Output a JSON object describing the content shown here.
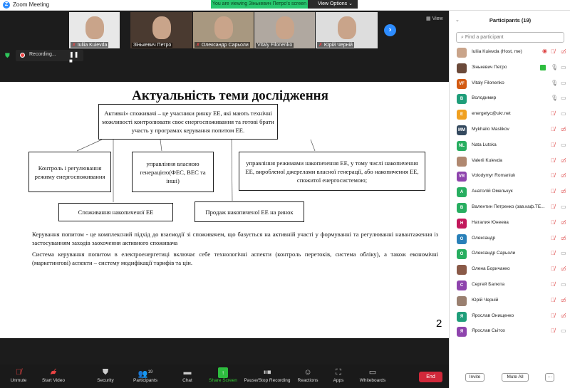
{
  "window": {
    "title": "Zoom Meeting",
    "viewing_banner": "You are viewing Зіньке­вич Петро's screen",
    "view_options": "View Options"
  },
  "videos": [
    {
      "name": "Iuliia Kuievda",
      "muted": true
    },
    {
      "name": "Зінькевич Петро",
      "muted": false
    },
    {
      "name": "Олександр Сарьоли",
      "muted": true
    },
    {
      "name": "Vitaly Filonenko",
      "muted": false
    },
    {
      "name": "Юрій Черній",
      "muted": true
    }
  ],
  "view_label": "View",
  "recording": {
    "label": "Recording..."
  },
  "slide": {
    "title": "Актуальність теми дослідження",
    "definition": "Активні» споживачі – це учасники ринку ЕЕ, які мають технічні можливості контролювати своє енергоспоживання та готові брати участь у програмах керування попитом ЕЕ.",
    "box_control": "Контроль і регулювання режиму енергоспоживання",
    "box_generation": "управління власною генерацією(ФЕС, ВЕС та інші)",
    "box_storage": "управління режимами накопичення ЕЕ, у тому числі накопичення ЕЕ, виробленої джерелами власної генерації, або накопичення ЕЕ, спожитої енергосистемою;",
    "box_consumption": "Споживання накопиченої ЕЕ",
    "box_sale": "Продаж накопиченої ЕЕ на ринок",
    "para1": "Керування попитом - це комплексний підхід до взаємодії зі споживачем, що базується на активній участі у формуванні та регулюванні навантаження із застосуванням заходів заохочення активного споживача",
    "para2": "Система керування попитом в електроенергетиці включає себе технологічні аспекти (контроль перетоків, система обліку), а також економічні (маркетингові) аспекти – систему модифікації тарифів та цін.",
    "page_number": "2"
  },
  "toolbar": {
    "unmute": "Unmute",
    "start_video": "Start Video",
    "security": "Security",
    "participants": "Participants",
    "participants_count": "19",
    "chat": "Chat",
    "share_screen": "Share Screen",
    "pause_stop": "Pause/Stop Recording",
    "reactions": "Reactions",
    "apps": "Apps",
    "whiteboards": "Whiteboards",
    "end": "End"
  },
  "panel": {
    "title": "Participants (19)",
    "search_placeholder": "Find a participant",
    "invite": "Invite",
    "mute_all": "Mute All",
    "more": "···",
    "participants": [
      {
        "name": "Iuliia Kuievda (Host, me)",
        "initials": "",
        "color": "#c9a48a",
        "mic": "muted",
        "cam": "off",
        "recording": true
      },
      {
        "name": "Зінькевич Петро",
        "initials": "",
        "color": "#6b4a3a",
        "mic": "on",
        "cam": "on",
        "sharing": true
      },
      {
        "name": "Vitaly Filonenko",
        "initials": "VF",
        "color": "#d35a12",
        "mic": "on",
        "cam": "on"
      },
      {
        "name": "Володимир",
        "initials": "B",
        "color": "#1f9e7a",
        "mic": "on",
        "cam": "on"
      },
      {
        "name": "energetyc@ukr.net",
        "initials": "E",
        "color": "#f0a020",
        "mic": "muted",
        "cam": "on"
      },
      {
        "name": "Mykhailo Maslikov",
        "initials": "MM",
        "color": "#34495e",
        "mic": "muted",
        "cam": "off"
      },
      {
        "name": "Nata Lutska",
        "initials": "NL",
        "color": "#27ae60",
        "mic": "muted",
        "cam": "on"
      },
      {
        "name": "Valerii Kuievda",
        "initials": "",
        "color": "#b08870",
        "mic": "muted",
        "cam": "off"
      },
      {
        "name": "Volodymyr Romaniuk",
        "initials": "VR",
        "color": "#8e44ad",
        "mic": "muted",
        "cam": "off"
      },
      {
        "name": "Анатолій Омельчук",
        "initials": "A",
        "color": "#27ae60",
        "mic": "muted",
        "cam": "off"
      },
      {
        "name": "Валентин Петренко (зав.каф.ТЕ...",
        "initials": "B",
        "color": "#27ae60",
        "mic": "muted",
        "cam": "on"
      },
      {
        "name": "Наталия Юнеева",
        "initials": "H",
        "color": "#c2185b",
        "mic": "muted",
        "cam": "off"
      },
      {
        "name": "Олександр",
        "initials": "O",
        "color": "#2980b9",
        "mic": "muted",
        "cam": "off"
      },
      {
        "name": "Олександр Сарьоли",
        "initials": "O",
        "color": "#27ae60",
        "mic": "muted",
        "cam": "on"
      },
      {
        "name": "Олена Боричанко",
        "initials": "",
        "color": "#8a5a48",
        "mic": "muted",
        "cam": "off"
      },
      {
        "name": "Сергей Балюта",
        "initials": "C",
        "color": "#8e44ad",
        "mic": "muted",
        "cam": "on"
      },
      {
        "name": "Юрій Черній",
        "initials": "",
        "color": "#9a8070",
        "mic": "muted",
        "cam": "off"
      },
      {
        "name": "Ярослав Онищенко",
        "initials": "Я",
        "color": "#1f9e7a",
        "mic": "muted",
        "cam": "off"
      },
      {
        "name": "Ярослав Сьітох",
        "initials": "Я",
        "color": "#8e44ad",
        "mic": "muted",
        "cam": "on"
      }
    ]
  }
}
